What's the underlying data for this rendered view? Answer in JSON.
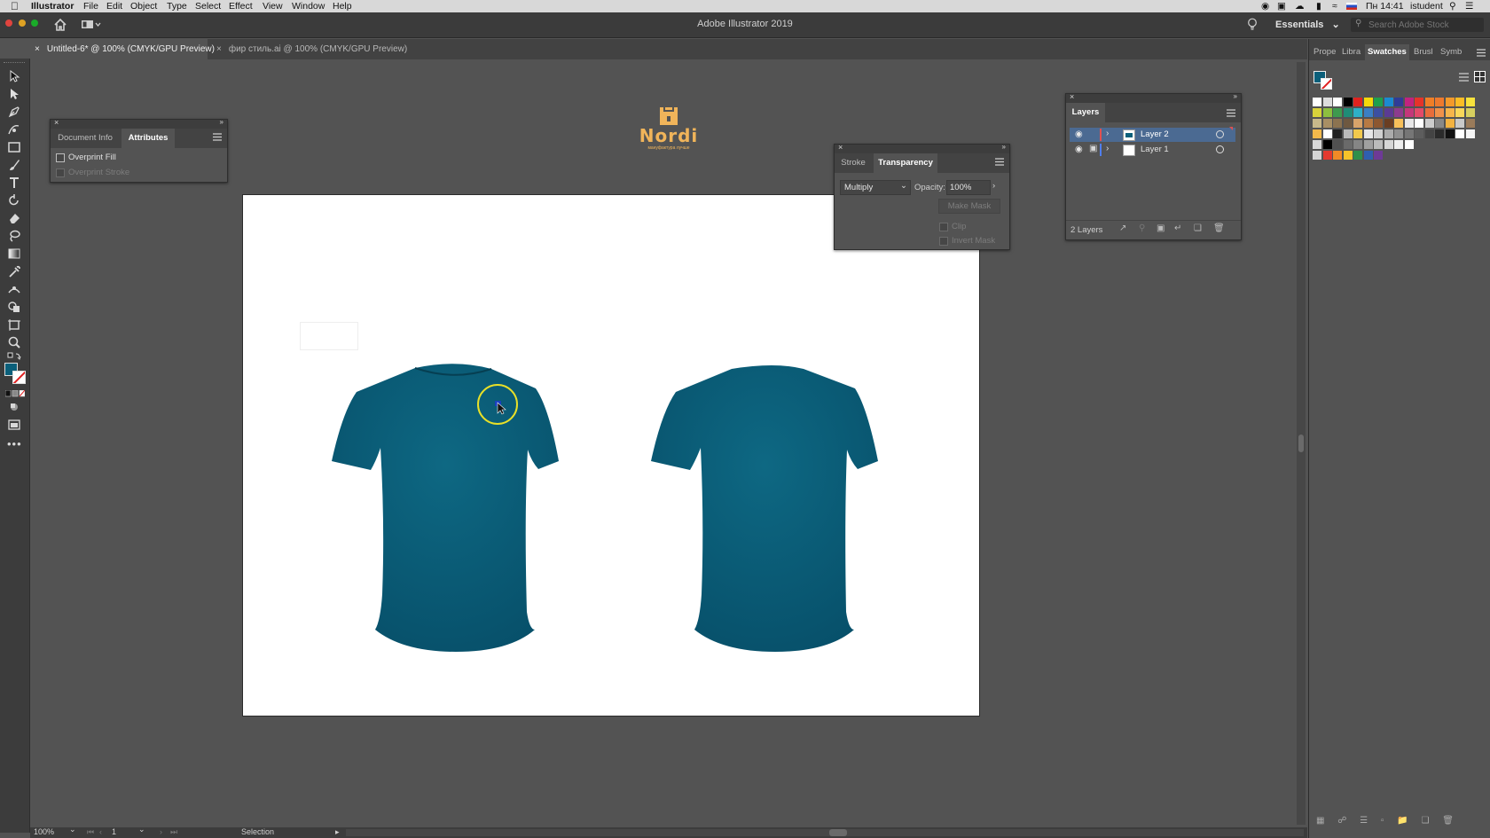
{
  "menubar": {
    "items": [
      "Illustrator",
      "File",
      "Edit",
      "Object",
      "Type",
      "Select",
      "Effect",
      "View",
      "Window",
      "Help"
    ],
    "clock": "Пн 14:41",
    "user": "istudent"
  },
  "window": {
    "title": "Adobe Illustrator 2019",
    "workspace": "Essentials",
    "search_placeholder": "Search Adobe Stock"
  },
  "tabs": [
    {
      "label": "Untitled-6* @ 100% (CMYK/GPU Preview)",
      "active": true
    },
    {
      "label": "фир стиль.ai @ 100% (CMYK/GPU Preview)",
      "active": false
    }
  ],
  "canvas": {
    "logo_text": "Nordi",
    "logo_subtext": "мануфактура лучше",
    "logo_color": "#f0b45a",
    "shirt_color": "#0b5f7a"
  },
  "attributes_panel": {
    "tabs": [
      "Document Info",
      "Attributes"
    ],
    "overprint_fill": "Overprint Fill",
    "overprint_stroke": "Overprint Stroke"
  },
  "transparency_panel": {
    "tabs": [
      "Stroke",
      "Transparency"
    ],
    "blend_mode": "Multiply",
    "opacity_label": "Opacity:",
    "opacity_value": "100%",
    "make_mask": "Make Mask",
    "clip": "Clip",
    "invert_mask": "Invert Mask"
  },
  "layers_panel": {
    "title": "Layers",
    "layers": [
      {
        "name": "Layer 2",
        "selected": true,
        "color": "#e05050"
      },
      {
        "name": "Layer 1",
        "selected": false,
        "color": "#4f7ef0"
      }
    ],
    "count": "2 Layers"
  },
  "dock": {
    "tabs": [
      "Prope",
      "Libra",
      "Swatches",
      "Brusl",
      "Symb"
    ]
  },
  "statusbar": {
    "zoom": "100%",
    "artboard": "1",
    "tool": "Selection"
  }
}
